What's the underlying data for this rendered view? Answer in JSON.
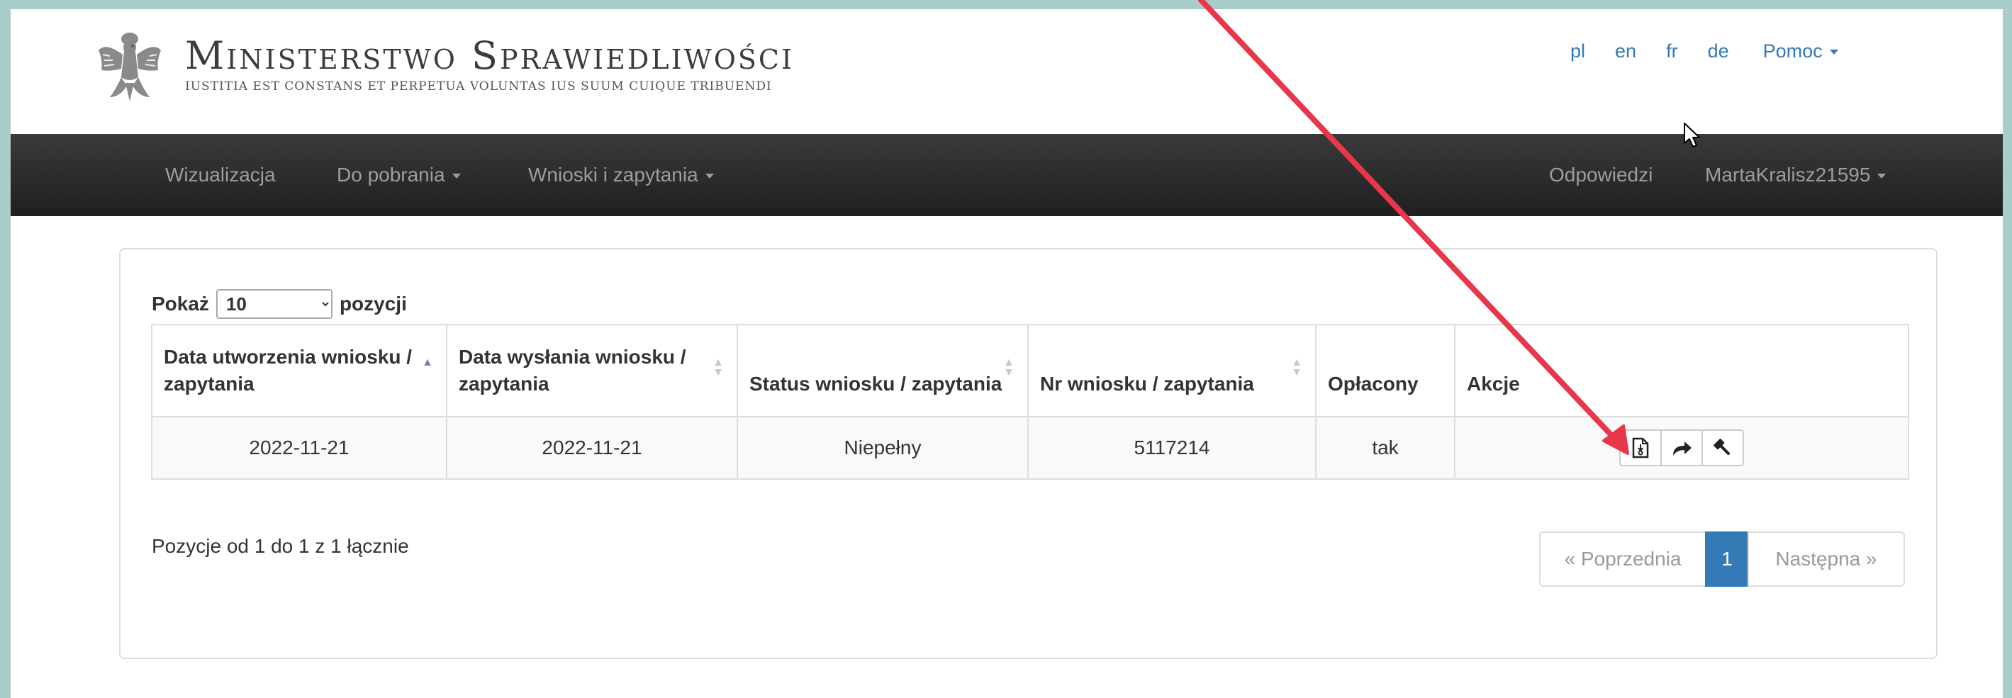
{
  "brand": {
    "title": "Ministerstwo Sprawiedliwości",
    "motto": "IUSTITIA EST CONSTANS ET PERPETUA VOLUNTAS IUS SUUM CUIQUE TRIBUENDI",
    "logo_icon": "polish-eagle-emblem"
  },
  "languages": [
    "pl",
    "en",
    "fr",
    "de"
  ],
  "help_label": "Pomoc",
  "nav": {
    "left": [
      "Wizualizacja",
      "Do pobrania",
      "Wnioski i zapytania"
    ],
    "right": [
      "Odpowiedzi",
      "MartaKralisz21595"
    ]
  },
  "table_controls": {
    "show_label": "Pokaż",
    "page_size": "10",
    "entries_label": "pozycji"
  },
  "table": {
    "headers": [
      "Data utworzenia wniosku / zapytania",
      "Data wysłania wniosku / zapytania",
      "Status wniosku / zapytania",
      "Nr wniosku / zapytania",
      "Opłacony",
      "Akcje"
    ],
    "rows": [
      {
        "created": "2022-11-21",
        "sent": "2022-11-21",
        "status": "Niepełny",
        "number": "5117214",
        "paid": "tak",
        "actions": [
          "document-icon",
          "share-arrow-icon",
          "gavel-icon"
        ]
      }
    ]
  },
  "footer": {
    "info": "Pozycje od 1 do 1 z 1 łącznie",
    "prev": "« Poprzednia",
    "page": "1",
    "next": "Następna »"
  },
  "colors": {
    "link": "#337ab7",
    "navbar": "#222222",
    "annotation_arrow": "#e8374a",
    "frame": "#a9cdca"
  }
}
